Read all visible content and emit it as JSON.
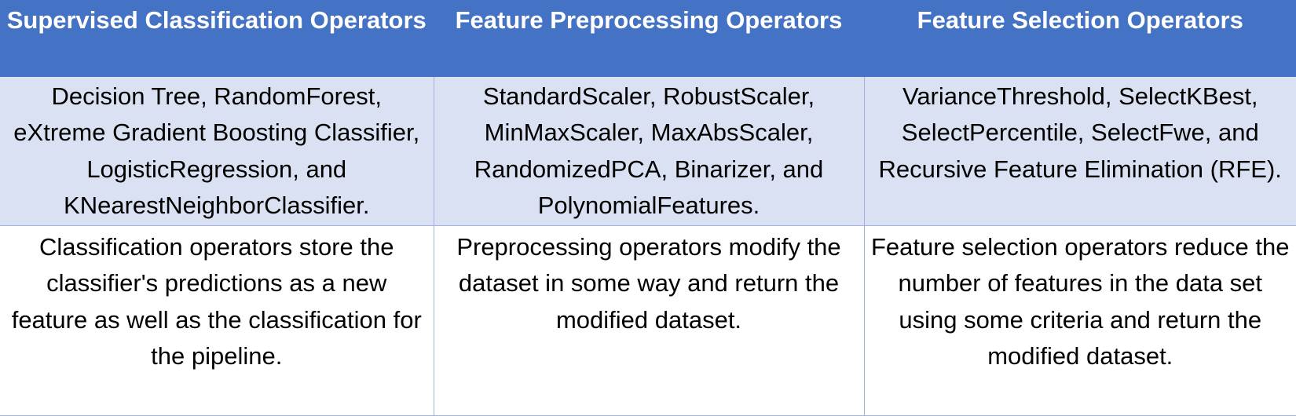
{
  "table": {
    "headers": [
      "Supervised Classification Operators",
      "Feature Preprocessing Operators",
      "Feature Selection Operators"
    ],
    "operators": [
      "Decision Tree, RandomForest, eXtreme Gradient Boosting Classifier, LogisticRegression, and KNearestNeighborClassifier.",
      "StandardScaler, RobustScaler, MinMaxScaler, MaxAbsScaler, RandomizedPCA, Binarizer, and PolynomialFeatures.",
      "VarianceThreshold, SelectKBest, SelectPercentile, SelectFwe, and Recursive Feature Elimination (RFE)."
    ],
    "descriptions": [
      "Classification operators store the classifier's predictions as a new feature as well as the classification for the pipeline.",
      "Preprocessing operators modify the dataset in some way and return the modified dataset.",
      "Feature selection operators reduce the number of features in the data set using some criteria and return the modified dataset."
    ]
  },
  "colors": {
    "header_bg": "#4472c4",
    "header_text": "#ffffff",
    "band_bg": "#d9e1f2",
    "border": "#9fb3dc"
  }
}
